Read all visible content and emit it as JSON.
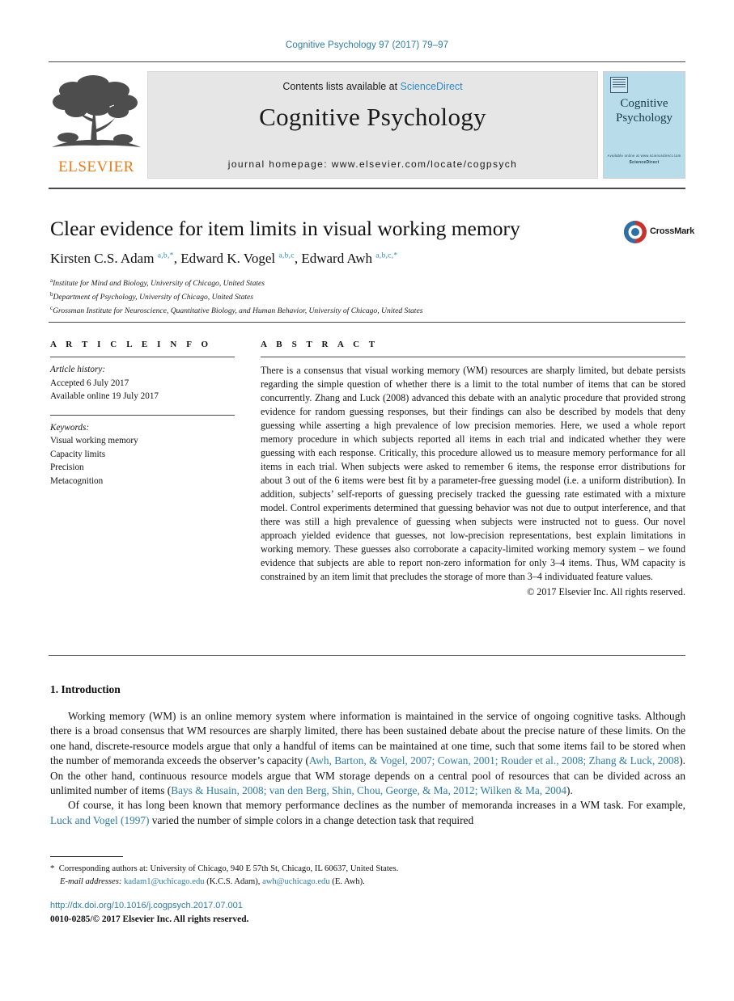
{
  "running_head": "Cognitive Psychology 97 (2017) 79–97",
  "masthead": {
    "contents_prefix": "Contents lists available at ",
    "sciencedirect": "ScienceDirect",
    "journal_title": "Cognitive Psychology",
    "homepage": "journal homepage: www.elsevier.com/locate/cogpsych",
    "publisher_name": "ELSEVIER",
    "cover": {
      "title_line1": "Cognitive",
      "title_line2": "Psychology",
      "footer_line1": "Available online at www.sciencedirect.com",
      "footer_line2": "ScienceDirect"
    }
  },
  "article": {
    "title": "Clear evidence for item limits in visual working memory",
    "crossmark_label": "CrossMark",
    "authors_html": "Kirsten C.S. Adam <sup>a,b,</sup><sup>*</sup>, Edward K. Vogel <sup>a,b,c</sup>, Edward Awh <sup>a,b,c,</sup><sup>*</sup>",
    "affiliations": [
      {
        "marker": "a",
        "text": "Institute for Mind and Biology, University of Chicago, United States"
      },
      {
        "marker": "b",
        "text": "Department of Psychology, University of Chicago, United States"
      },
      {
        "marker": "c",
        "text": "Grossman Institute for Neuroscience, Quantitative Biology, and Human Behavior, University of Chicago, United States"
      }
    ]
  },
  "article_info": {
    "heading": "A R T I C L E   I N F O",
    "history_label": "Article history:",
    "history": [
      "Accepted 6 July 2017",
      "Available online 19 July 2017"
    ],
    "keywords_label": "Keywords:",
    "keywords": [
      "Visual working memory",
      "Capacity limits",
      "Precision",
      "Metacognition"
    ]
  },
  "abstract": {
    "heading": "A B S T R A C T",
    "text": "There is a consensus that visual working memory (WM) resources are sharply limited, but debate persists regarding the simple question of whether there is a limit to the total number of items that can be stored concurrently. Zhang and Luck (2008) advanced this debate with an analytic procedure that provided strong evidence for random guessing responses, but their findings can also be described by models that deny guessing while asserting a high prevalence of low precision memories. Here, we used a whole report memory procedure in which subjects reported all items in each trial and indicated whether they were guessing with each response. Critically, this procedure allowed us to measure memory performance for all items in each trial. When subjects were asked to remember 6 items, the response error distributions for about 3 out of the 6 items were best fit by a parameter-free guessing model (i.e. a uniform distribution). In addition, subjects’ self-reports of guessing precisely tracked the guessing rate estimated with a mixture model. Control experiments determined that guessing behavior was not due to output interference, and that there was still a high prevalence of guessing when subjects were instructed not to guess. Our novel approach yielded evidence that guesses, not low-precision representations, best explain limitations in working memory. These guesses also corroborate a capacity-limited working memory system – we found evidence that subjects are able to report non-zero information for only 3–4 items. Thus, WM capacity is constrained by an item limit that precludes the storage of more than 3–4 individuated feature values.",
    "copyright": "© 2017 Elsevier Inc. All rights reserved."
  },
  "body": {
    "section_heading": "1. Introduction",
    "paragraph1_html": "Working memory (WM) is an online memory system where information is maintained in the service of ongoing cognitive tasks. Although there is a broad consensus that WM resources are sharply limited, there has been sustained debate about the precise nature of these limits. On the one hand, discrete-resource models argue that only a handful of items can be maintained at one time, such that some items fail to be stored when the number of memoranda exceeds the observer’s capacity (<span class=\"ref\">Awh, Barton, &amp; Vogel, 2007; Cowan, 2001; Rouder et al., 2008; Zhang &amp; Luck, 2008</span>). On the other hand, continuous resource models argue that WM storage depends on a central pool of resources that can be divided across an unlimited number of items (<span class=\"ref\">Bays &amp; Husain, 2008; van den Berg, Shin, Chou, George, &amp; Ma, 2012; Wilken &amp; Ma, 2004</span>).",
    "paragraph2_html": "Of course, it has long been known that memory performance declines as the number of memoranda increases in a WM task. For example, <span class=\"ref\">Luck and Vogel (1997)</span> varied the number of simple colors in a change detection task that required"
  },
  "footnotes": {
    "corresponding_html": "<span class=\"fn-star\">*</span>&nbsp; Corresponding authors at: University of Chicago, 940 E 57th St, Chicago, IL 60637, United States.",
    "email_html": "<span class=\"em-lab\">E-mail addresses:</span> <span class=\"ref\">kadam1@uchicago.edu</span> (K.C.S. Adam), <span class=\"ref\">awh@uchicago.edu</span> (E. Awh)."
  },
  "footer": {
    "doi": "http://dx.doi.org/10.1016/j.cogpsych.2017.07.001",
    "issn_line": "0010-0285/© 2017 Elsevier Inc. All rights reserved."
  },
  "colors": {
    "link": "#2e7ca6",
    "sciencedirect": "#2e8bc0",
    "elsevier_orange": "#e87d1e",
    "cover_blue": "#b9dcea",
    "band_gray": "#e6e6e6"
  }
}
